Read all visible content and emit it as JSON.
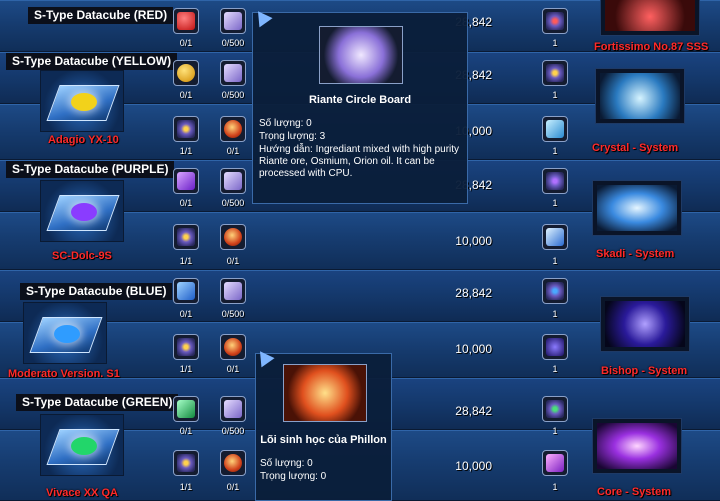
{
  "groups": [
    {
      "label": "S-Type Datacube (RED)",
      "item_name": "",
      "gem_color": "#ff2a2a"
    },
    {
      "label": "S-Type Datacube (YELLOW)",
      "item_name": "Adagio YX-10",
      "gem_color": "#f2d21b"
    },
    {
      "label": "S-Type Datacube (PURPLE)",
      "item_name": "SC-Dolc-9S",
      "gem_color": "#8a3cff"
    },
    {
      "label": "S-Type Datacube (BLUE)",
      "item_name": "Moderato Version. S1",
      "gem_color": "#2f9cff"
    },
    {
      "label": "S-Type Datacube (GREEN)",
      "item_name": "Vivace XX QA",
      "gem_color": "#22d66a"
    }
  ],
  "rows": [
    {
      "c1": "0/1",
      "c2": "0/500",
      "value": "28,842",
      "right": "1"
    },
    {
      "c1": "0/1",
      "c2": "0/500",
      "value": "28,842",
      "right": "1"
    },
    {
      "c1": "1/1",
      "c2": "0/1",
      "value": "10,000",
      "right": "1"
    },
    {
      "c1": "0/1",
      "c2": "0/500",
      "value": "28,842",
      "right": "1"
    },
    {
      "c1": "1/1",
      "c2": "0/1",
      "value": "10,000",
      "right": "1"
    },
    {
      "c1": "0/1",
      "c2": "0/500",
      "value": "28,842",
      "right": "1"
    },
    {
      "c1": "1/1",
      "c2": "0/1",
      "value": "10,000",
      "right": "1"
    },
    {
      "c1": "0/1",
      "c2": "0/500",
      "value": "28,842",
      "right": "1"
    },
    {
      "c1": "1/1",
      "c2": "0/1",
      "value": "10,000",
      "right": "1"
    }
  ],
  "rewards": [
    {
      "label": "Fortissimo No.87 SSS",
      "color": "#ff4040"
    },
    {
      "label": "Crystal - System",
      "color": "#7fd8ff"
    },
    {
      "label": "Skadi - System",
      "color": "#66b8ff"
    },
    {
      "label": "Bishop - System",
      "color": "#5a3cff"
    },
    {
      "label": "Core - System",
      "color": "#b040ff"
    }
  ],
  "tooltip1": {
    "title": "Riante Circle Board",
    "quantity": "Số lượng: 0",
    "weight": "Trọng lượng: 3",
    "guide": "Hướng dẫn: Ingrediant mixed with high purity Riante ore, Osmium, Orion oil. It can be processed with CPU."
  },
  "tooltip2": {
    "title": "Lõi sinh học của Phillon",
    "quantity": "Số lượng: 0",
    "weight": "Trọng lượng: 0"
  }
}
